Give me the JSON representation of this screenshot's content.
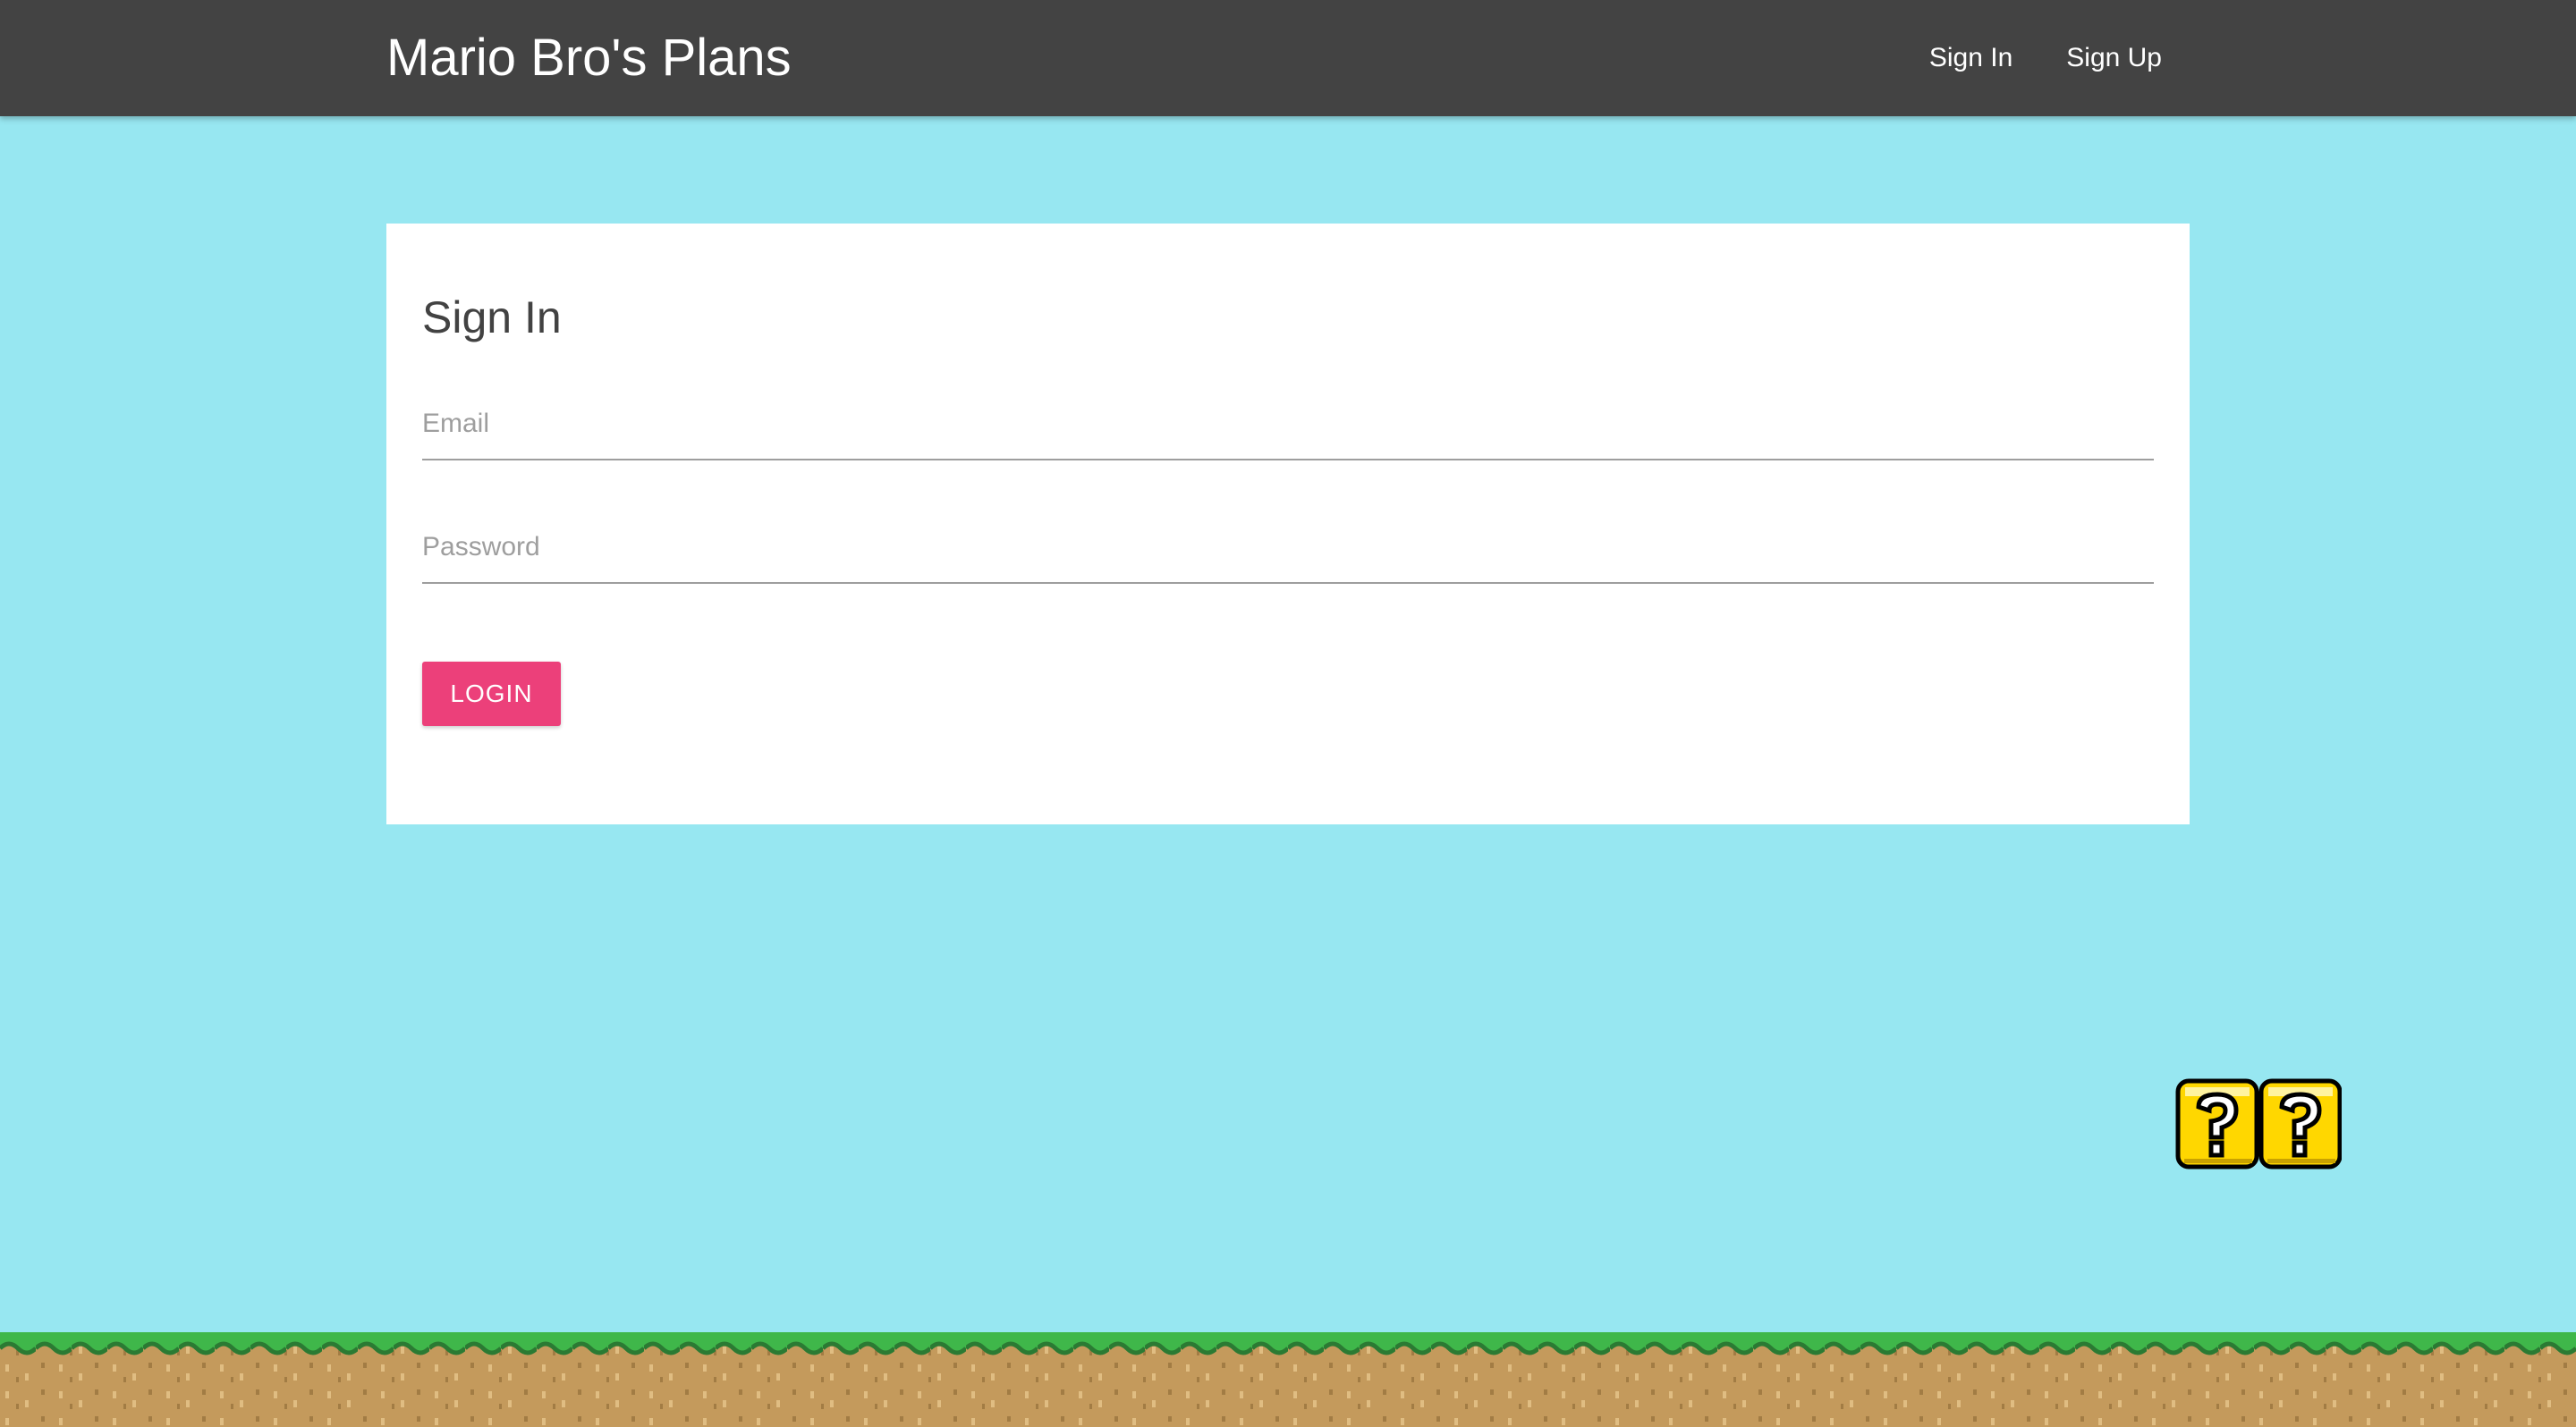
{
  "navbar": {
    "brand": "Mario Bro's Plans",
    "links": [
      {
        "label": "Sign In"
      },
      {
        "label": "Sign Up"
      }
    ]
  },
  "signin_form": {
    "title": "Sign In",
    "email_placeholder": "Email",
    "password_placeholder": "Password",
    "login_label": "LOGIN"
  },
  "colors": {
    "navbar": "#434343",
    "sky": "#97e7f1",
    "login_button": "#ec407a",
    "question_block": "#ffd700",
    "grass": "#3fb74a",
    "dirt": "#c49a5c"
  },
  "decorations": {
    "question_blocks": [
      "question-block-icon",
      "question-block-icon"
    ],
    "ground": "grass-ground"
  }
}
